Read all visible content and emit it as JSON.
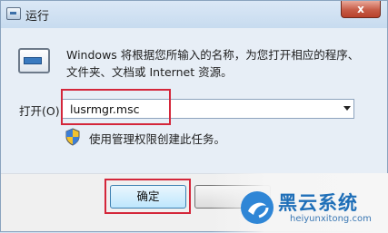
{
  "window": {
    "title": "运行",
    "close_symbol": "x"
  },
  "description": {
    "line1": "Windows 将根据您所输入的名称，为您打开相应的程序、",
    "line2": "文件夹、文档或 Internet 资源。"
  },
  "open_field": {
    "label": "打开(O):",
    "value": "lusrmgr.msc"
  },
  "admin_note": "使用管理权限创建此任务。",
  "buttons": {
    "ok_label": "确定"
  },
  "watermark": {
    "brand": "黑云系统",
    "url": "heiyunxitong.com"
  },
  "colors": {
    "highlight": "#d4263a",
    "watermark": "#1f6fb8"
  },
  "icons": [
    "run-icon",
    "shield-icon",
    "close-icon",
    "dropdown-arrow-icon",
    "watermark-logo-icon"
  ]
}
